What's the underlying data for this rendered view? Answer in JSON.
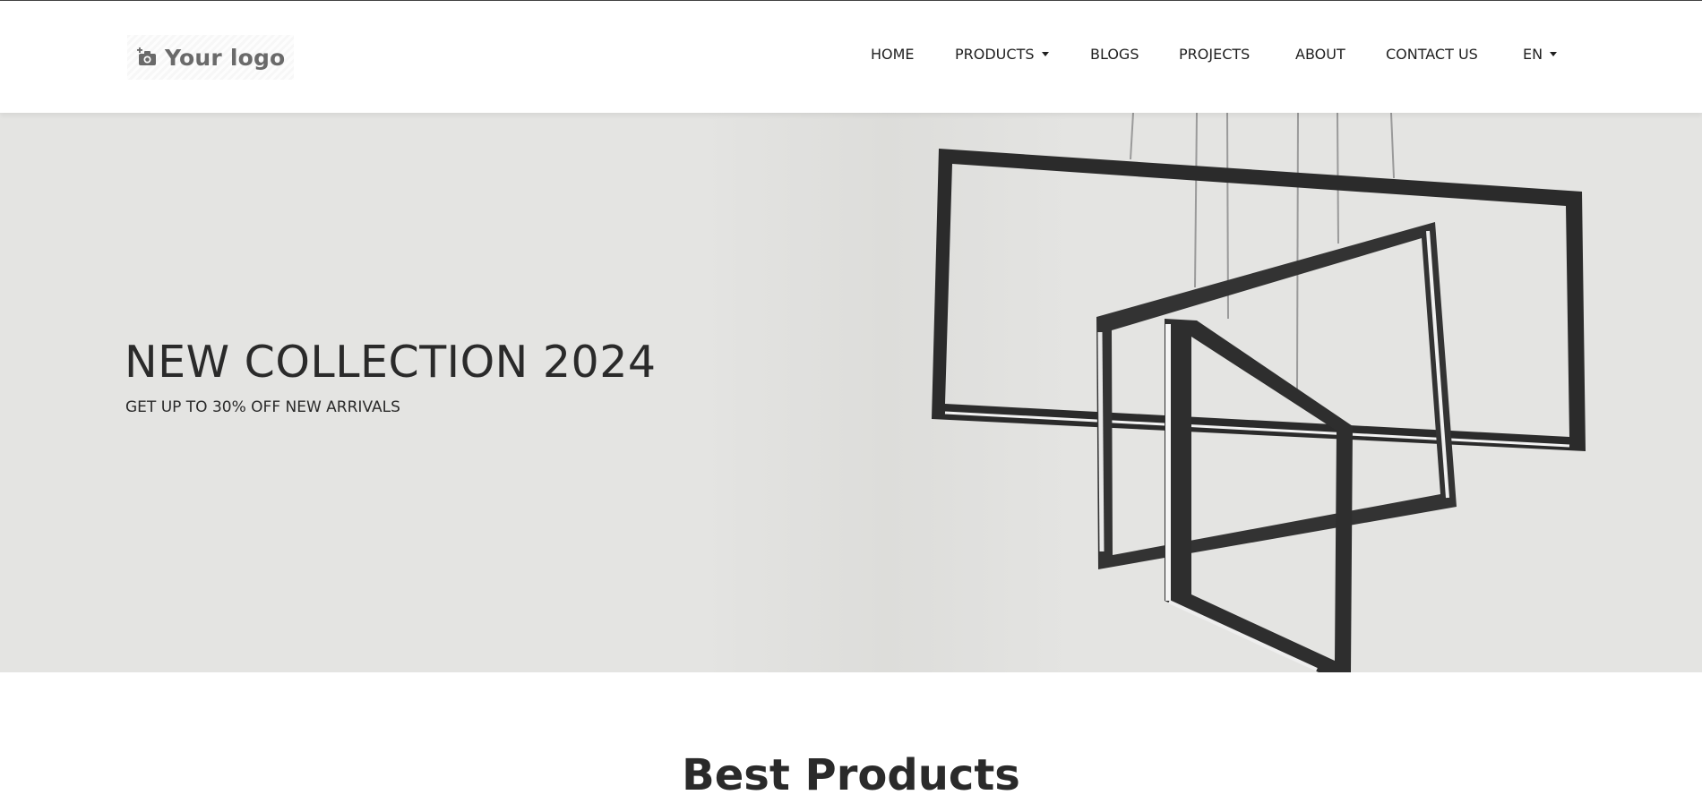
{
  "header": {
    "logo_text": "Your logo",
    "nav": {
      "home": "HOME",
      "products": "PRODUCTS",
      "blogs": "BLOGS",
      "projects": "PROJECTS",
      "about": "ABOUT",
      "contact": "CONTACT US",
      "language": "EN"
    }
  },
  "hero": {
    "title": "NEW COLLECTION 2024",
    "subtitle": "GET UP TO 30% OFF NEW ARRIVALS",
    "image": "geometric-pendant-chandelier"
  },
  "sections": {
    "best_products_title": "Best Products"
  },
  "icons": {
    "logo": "camera-plus-icon",
    "dropdown": "caret-down-icon"
  },
  "colors": {
    "hero_background": "#e4e4e2",
    "text_dark": "#2a2a2a",
    "logo_gray": "#6a6a6a"
  }
}
